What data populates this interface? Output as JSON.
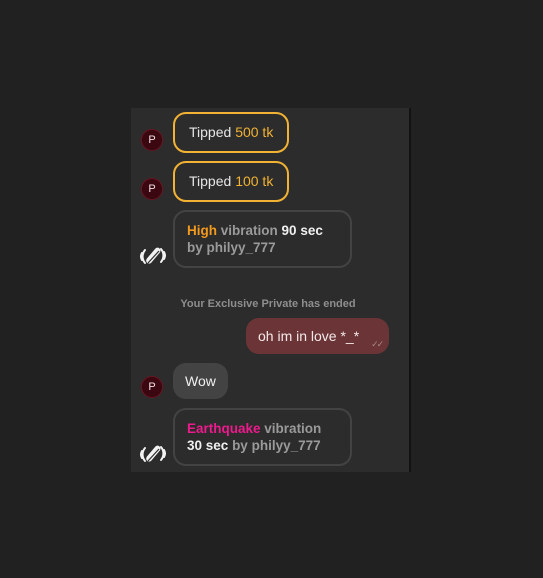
{
  "chat": {
    "avatar_initial": "P",
    "tips": [
      {
        "prefix": "Tipped",
        "amount": "500 tk"
      },
      {
        "prefix": "Tipped",
        "amount": "100 tk"
      }
    ],
    "vibrations": [
      {
        "level": "High",
        "word_vibration": "vibration",
        "duration": "90 sec",
        "word_by": "by",
        "user": "philyy_777"
      },
      {
        "level": "Earthquake",
        "word_vibration": "vibration",
        "duration": "30 sec",
        "word_by": "by",
        "user": "philyy_777"
      }
    ],
    "system_note": "Your Exclusive Private has ended",
    "my_message": {
      "text": "oh im in love *_*",
      "status_icon": "double-check-icon"
    },
    "their_message": {
      "text": "Wow"
    },
    "icons": {
      "avatar": "user-initial-avatar",
      "toy": "vibrating-toy-icon"
    },
    "colors": {
      "tip_accent": "#f2b233",
      "high_level": "#f39a1c",
      "earthquake_level": "#ec1a8c",
      "my_bubble": "#6b3537",
      "their_bubble": "#434343",
      "avatar_bg": "#3b0710"
    }
  }
}
